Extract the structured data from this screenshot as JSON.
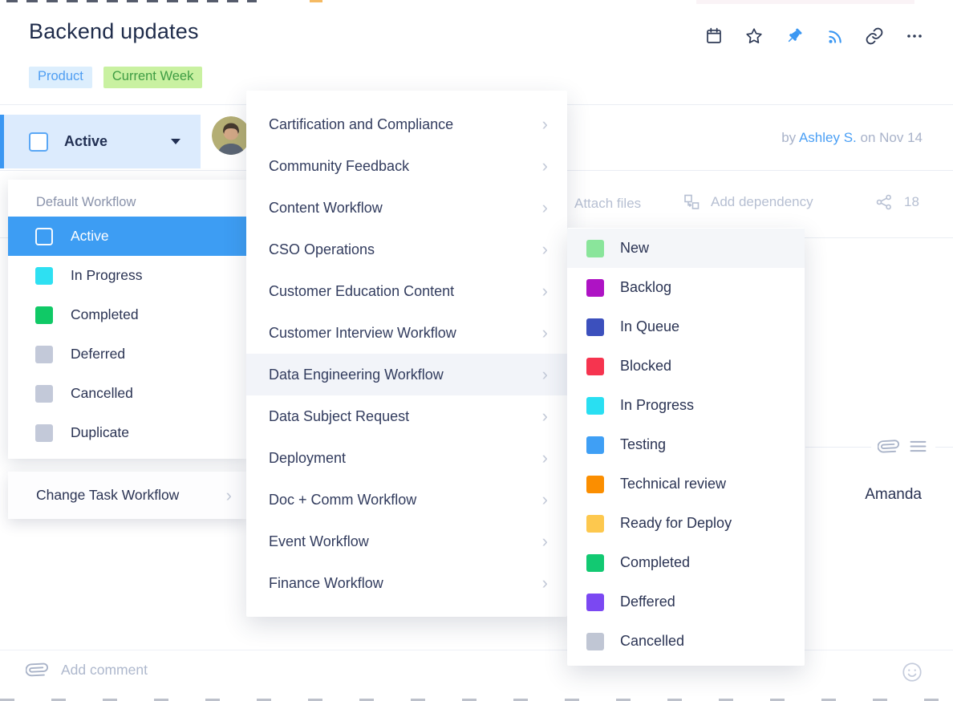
{
  "header": {
    "title": "Backend updates",
    "tags": [
      {
        "label": "Product",
        "bg": "#dceefd",
        "color": "#4f9ef2"
      },
      {
        "label": "Current Week",
        "bg": "#c9f1a1",
        "color": "#3f9d44"
      }
    ],
    "toolbar_icons": [
      "calendar-icon",
      "star-icon",
      "pin-icon",
      "rss-icon",
      "link-icon",
      "more-icon"
    ],
    "accent_blue": "#3b97f2"
  },
  "task_bar": {
    "status_label": "Active",
    "byline": {
      "prefix": "by",
      "author": "Ashley S.",
      "suffix": "on Nov 14"
    }
  },
  "attach_bar": {
    "attach_files": "Attach files",
    "add_dependency": "Add dependency",
    "dependency_count": "18"
  },
  "workflow_panel": {
    "header": "Default Workflow",
    "items": [
      {
        "label": "Active",
        "color": "transparent",
        "selected": true
      },
      {
        "label": "In Progress",
        "color": "#2ee0f2"
      },
      {
        "label": "Completed",
        "color": "#10c966"
      },
      {
        "label": "Deferred",
        "color": "#c3c9d9"
      },
      {
        "label": "Cancelled",
        "color": "#c3c9d9"
      },
      {
        "label": "Duplicate",
        "color": "#c3c9d9"
      }
    ],
    "footer": "Change Task Workflow",
    "selected_bg": "#3d9df3"
  },
  "workflow_menu": {
    "items": [
      {
        "label": "Cartification and Compliance"
      },
      {
        "label": "Community Feedback"
      },
      {
        "label": "Content Workflow"
      },
      {
        "label": "CSO Operations"
      },
      {
        "label": "Customer Education Content"
      },
      {
        "label": "Customer Interview Workflow"
      },
      {
        "label": "Data Engineering Workflow",
        "highlighted": true
      },
      {
        "label": "Data Subject Request"
      },
      {
        "label": "Deployment"
      },
      {
        "label": "Doc + Comm Workflow"
      },
      {
        "label": "Event Workflow"
      },
      {
        "label": "Finance Workflow"
      }
    ]
  },
  "status_submenu": {
    "items": [
      {
        "label": "New",
        "color": "#8ae59b",
        "highlighted": true
      },
      {
        "label": "Backlog",
        "color": "#ae13c4"
      },
      {
        "label": "In Queue",
        "color": "#3c50bd"
      },
      {
        "label": "Blocked",
        "color": "#f6344f"
      },
      {
        "label": "In Progress",
        "color": "#29dff2"
      },
      {
        "label": "Testing",
        "color": "#3f9ff5"
      },
      {
        "label": "Technical review",
        "color": "#fb8e00"
      },
      {
        "label": "Ready for Deploy",
        "color": "#fdc84e"
      },
      {
        "label": "Completed",
        "color": "#12c972"
      },
      {
        "label": "Deffered",
        "color": "#7b48f2"
      },
      {
        "label": "Cancelled",
        "color": "#c0c6d4"
      }
    ]
  },
  "content": {
    "assignee": "Amanda"
  },
  "comment_bar": {
    "placeholder": "Add comment",
    "icons": [
      "paperclip-icon",
      "smiley-icon"
    ]
  }
}
